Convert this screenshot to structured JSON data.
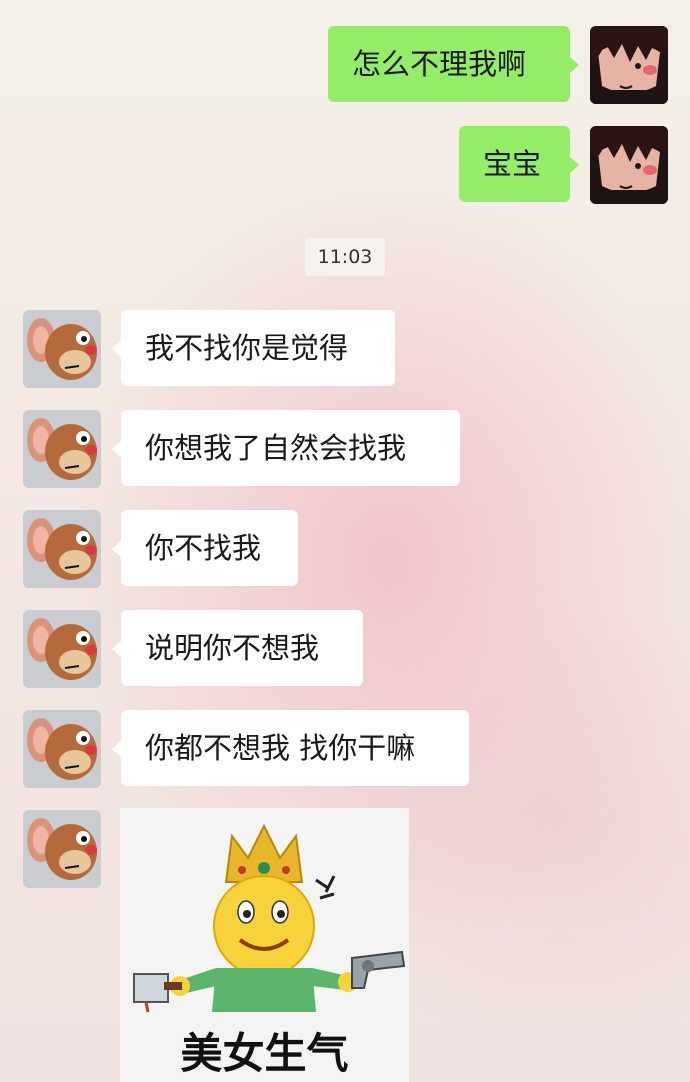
{
  "outgoing": [
    {
      "text": "怎么不理我啊"
    },
    {
      "text": "宝宝"
    }
  ],
  "timestamp": "11:03",
  "incoming": [
    {
      "text": "我不找你是觉得"
    },
    {
      "text": "你想我了自然会找我"
    },
    {
      "text": "你不找我"
    },
    {
      "text": "说明你不想我"
    },
    {
      "text": "你都不想我 找你干嘛"
    }
  ],
  "sticker": {
    "caption": "美女生气"
  },
  "colors": {
    "outgoing_bubble": "#95ec69",
    "incoming_bubble": "#ffffff"
  },
  "icons": {
    "self_avatar": "anime-boy-avatar",
    "contact_avatar": "jerry-mouse-avatar"
  }
}
